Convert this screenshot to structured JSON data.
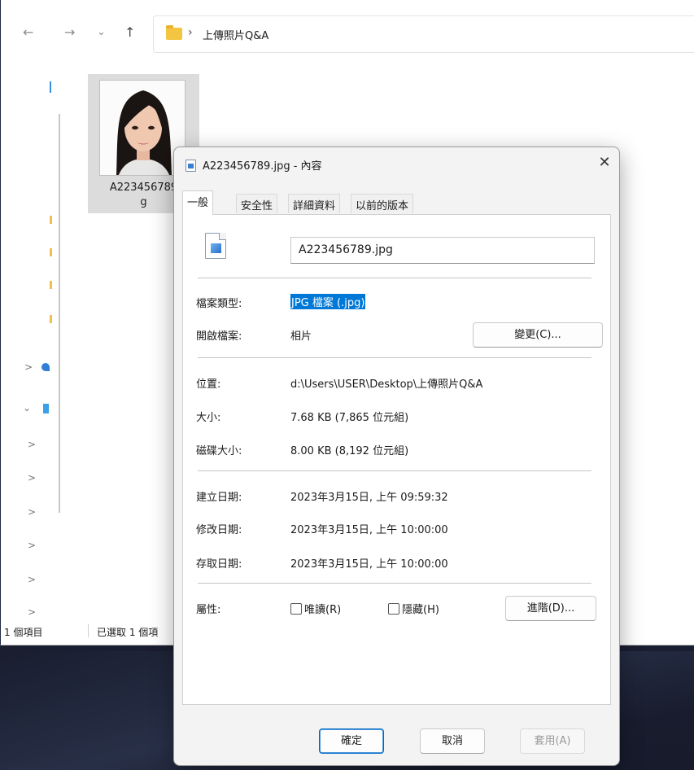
{
  "explorer": {
    "nav": {
      "back_glyph": "←",
      "forward_glyph": "→",
      "recent_glyph": "⌄",
      "up_glyph": "↑"
    },
    "address": {
      "separator": "›",
      "path": "上傳照片Q&A"
    },
    "sidebar": {
      "chevrons": [
        ">",
        "⌄",
        ">",
        ">",
        ">",
        ">",
        ">",
        ">"
      ]
    },
    "file": {
      "name_line1": "A223456789",
      "name_line2": "g"
    },
    "status": {
      "item_count": "1 個項目",
      "selected": "已選取 1 個項"
    }
  },
  "dialog": {
    "title": "A223456789.jpg - 內容",
    "close_glyph": "✕",
    "tabs": [
      "一般",
      "安全性",
      "詳細資料",
      "以前的版本"
    ],
    "active_tab": "一般",
    "filename": "A223456789.jpg",
    "file_type": {
      "label": "檔案類型:",
      "value": "JPG 檔案 (.jpg)"
    },
    "opens_with": {
      "label": "開啟檔案:",
      "value": "相片",
      "button": "變更(C)..."
    },
    "location": {
      "label": "位置:",
      "value": "d:\\Users\\USER\\Desktop\\上傳照片Q&A"
    },
    "size": {
      "label": "大小:",
      "value": "7.68 KB (7,865 位元組)"
    },
    "size_on_disk": {
      "label": "磁碟大小:",
      "value": "8.00 KB (8,192 位元組)"
    },
    "created": {
      "label": "建立日期:",
      "value": "2023年3月15日, 上午 09:59:32"
    },
    "modified": {
      "label": "修改日期:",
      "value": "2023年3月15日, 上午 10:00:00"
    },
    "accessed": {
      "label": "存取日期:",
      "value": "2023年3月15日, 上午 10:00:00"
    },
    "attributes": {
      "label": "屬性:",
      "readonly": {
        "label": "唯讀(R)",
        "checked": false
      },
      "hidden": {
        "label": "隱藏(H)",
        "checked": false
      },
      "advanced_button": "進階(D)..."
    },
    "footer": {
      "ok": "確定",
      "cancel": "取消",
      "apply": "套用(A)"
    }
  },
  "colors": {
    "selection": "#0078d7",
    "dialog_bg": "#f3f3f3",
    "desktop_bg": "#1d2236",
    "folder": "#f4c541"
  }
}
